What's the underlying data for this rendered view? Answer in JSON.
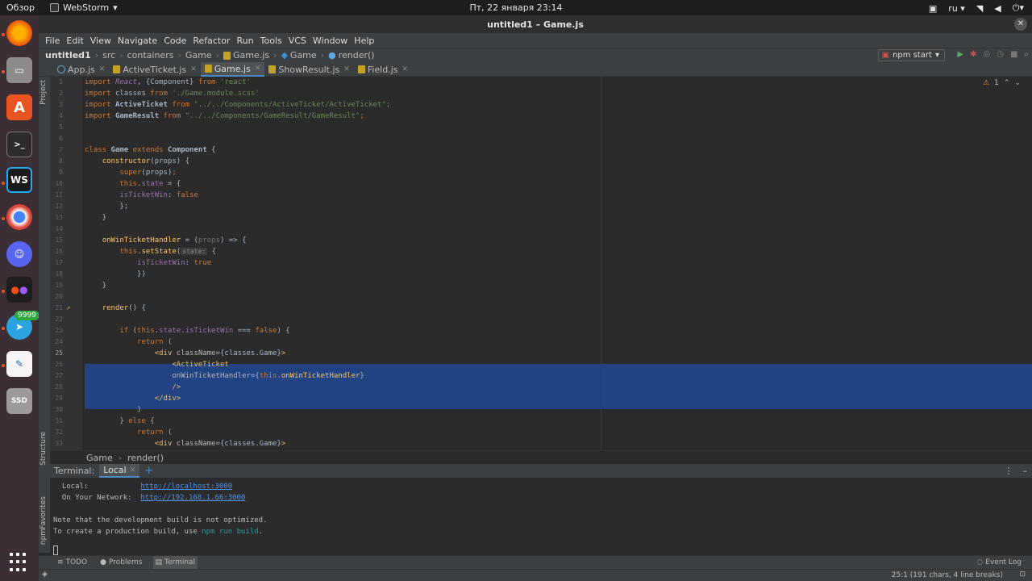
{
  "topbar": {
    "activities": "Обзор",
    "app_name": "WebStorm",
    "clock": "Пт, 22 января  23:14",
    "lang": "ru"
  },
  "dock": {
    "telegram_badge": "9999",
    "ssd_label": "SSD",
    "ws_label": "WS"
  },
  "ide": {
    "title": "untitled1 – Game.js",
    "menu": [
      "File",
      "Edit",
      "View",
      "Navigate",
      "Code",
      "Refactor",
      "Run",
      "Tools",
      "VCS",
      "Window",
      "Help"
    ],
    "breadcrumb": [
      "untitled1",
      "src",
      "containers",
      "Game",
      "Game.js",
      "Game",
      "render()"
    ],
    "run_config": "npm start",
    "tabs": [
      {
        "label": "App.js",
        "icon": "react"
      },
      {
        "label": "ActiveTicket.js",
        "icon": "js"
      },
      {
        "label": "Game.js",
        "icon": "js",
        "active": true
      },
      {
        "label": "ShowResult.js",
        "icon": "js"
      },
      {
        "label": "Field.js",
        "icon": "js"
      }
    ],
    "warnings": "1",
    "side_labels": {
      "project": "Project",
      "structure": "Structure",
      "favorites": "Favorites",
      "npm": "npm"
    },
    "line_numbers": [
      "1",
      "2",
      "3",
      "4",
      "5",
      "6",
      "7",
      "8",
      "9",
      "10",
      "11",
      "12",
      "13",
      "14",
      "15",
      "16",
      "17",
      "18",
      "19",
      "20",
      "21",
      "22",
      "23",
      "24",
      "25",
      "26",
      "27",
      "28",
      "29",
      "30",
      "31",
      "32",
      "33"
    ],
    "code_crumbs": [
      "Game",
      "render()"
    ]
  },
  "code": {
    "l1": {
      "a": "import ",
      "b": "React",
      "c": ", {Component} ",
      "d": "from ",
      "e": "'react'"
    },
    "l2": {
      "a": "import ",
      "b": "classes ",
      "c": "from ",
      "d": "'./Game.module.scss'"
    },
    "l3": {
      "a": "import ",
      "b": "ActiveTicket ",
      "c": "from ",
      "d": "\"../../Components/ActiveTicket/ActiveTicket\"",
      "e": ";"
    },
    "l4": {
      "a": "import ",
      "b": "GameResult ",
      "c": "from ",
      "d": "\"../../Components/GameResult/GameResult\"",
      "e": ";"
    },
    "l7": {
      "a": "class ",
      "b": "Game ",
      "c": "extends ",
      "d": "Component ",
      "e": "{"
    },
    "l8": {
      "a": "    ",
      "b": "constructor",
      "c": "(props) {"
    },
    "l9": {
      "a": "        ",
      "b": "super",
      "c": "(props)",
      "d": ";"
    },
    "l10": {
      "a": "        ",
      "b": "this",
      "c": ".",
      "d": "state",
      "e": " = {"
    },
    "l11": {
      "a": "        ",
      "b": "isTicketWin",
      "c": ": ",
      "d": "false"
    },
    "l12": {
      "a": "        };"
    },
    "l13": {
      "a": "    }"
    },
    "l15": {
      "a": "    ",
      "b": "onWinTicketHandler",
      "c": " = (",
      "d": "props",
      "e": ") => {"
    },
    "l16": {
      "a": "        ",
      "b": "this",
      "c": ".",
      "d": "setState",
      "e": "(",
      "f": "state:",
      "g": " {"
    },
    "l17": {
      "a": "            ",
      "b": "isTicketWin",
      "c": ": ",
      "d": "true"
    },
    "l18": {
      "a": "            })"
    },
    "l19": {
      "a": "    }"
    },
    "l21": {
      "a": "    ",
      "b": "render",
      "c": "() {"
    },
    "l23": {
      "a": "        ",
      "b": "if ",
      "c": "(",
      "d": "this",
      "e": ".",
      "f": "state",
      "g": ".",
      "h": "isTicketWin",
      "i": " === ",
      "j": "false",
      "k": ") {"
    },
    "l24": {
      "a": "            ",
      "b": "return ",
      "c": "("
    },
    "l25": {
      "a": "                ",
      "b": "<div ",
      "c": "className",
      "d": "={classes.Game}",
      "e": ">"
    },
    "l26": {
      "a": "                    ",
      "b": "<ActiveTicket"
    },
    "l27": {
      "a": "                    ",
      "b": "onWinTicketHandler",
      "c": "={",
      "d": "this",
      "e": ".",
      "f": "onWinTicketHandler",
      "g": "}"
    },
    "l28": {
      "a": "                    ",
      "b": "/>"
    },
    "l29": {
      "a": "                ",
      "b": "</div>"
    },
    "l30": {
      "a": "            )"
    },
    "l31": {
      "a": "        } ",
      "b": "else ",
      "c": "{"
    },
    "l32": {
      "a": "            ",
      "b": "return ",
      "c": "("
    },
    "l33": {
      "a": "                ",
      "b": "<div ",
      "c": "className",
      "d": "={classes.Game}",
      "e": ">"
    }
  },
  "terminal": {
    "label": "Terminal:",
    "tab": "Local",
    "add": "+",
    "l1": {
      "a": "  Local:            ",
      "b": "http://localhost:3000"
    },
    "l2": {
      "a": "  On Your Network:  ",
      "b": "http://192.168.1.66:3000"
    },
    "l4": {
      "a": "Note that the development build is not optimized."
    },
    "l5": {
      "a": "To create a production build, use ",
      "b": "npm run build",
      "c": "."
    }
  },
  "toolwindows": {
    "todo": "TODO",
    "problems": "Problems",
    "terminal": "Terminal",
    "event_log": "Event Log"
  },
  "status": {
    "position": "25:1 (191 chars, 4 line breaks)"
  }
}
